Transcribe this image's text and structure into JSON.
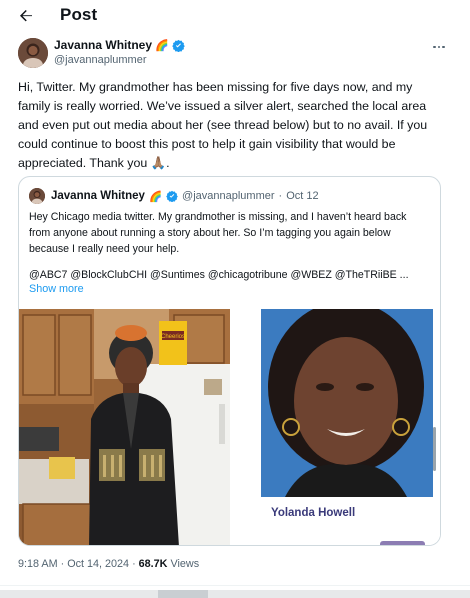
{
  "header": {
    "title": "Post"
  },
  "author": {
    "name": "Javanna Whitney",
    "handle": "@javannaplummer",
    "emoji": "🌈"
  },
  "tweet": {
    "text": "Hi, Twitter. My grandmother has been missing for five days now, and my family is really worried. We’ve issued a silver alert, searched the local area and even put out media about her (see thread below) but to no avail. If you could continue to boost this post to help it gain visibility that would be appreciated. Thank you 🙏🏽."
  },
  "quote": {
    "name": "Javanna Whitney",
    "emoji": "🌈",
    "handle": "@javannaplummer",
    "separator": "·",
    "date": "Oct 12",
    "text": "Hey Chicago media twitter. My grandmother is missing, and I haven’t heard back from anyone about running a story about her. So I’m tagging you again below because I really need your help.",
    "mentions": "@ABC7 @BlockClubCHI @Suntimes @chicagotribune @WBEZ @TheTRiiBE ...",
    "show_more": "Show more",
    "images": {
      "left_cereal": "Cheerios",
      "right_caption": "Yolanda Howell"
    }
  },
  "meta": {
    "time": "9:18 AM",
    "separator": "·",
    "date": "Oct 14, 2024",
    "separator2": "·",
    "views_count": "68.7K",
    "views_label": "Views"
  },
  "colors": {
    "accent": "#1d9bf0",
    "text": "#0f1419",
    "secondary": "#536471",
    "border": "#cfd9de",
    "verified": "#1d9bf0"
  }
}
